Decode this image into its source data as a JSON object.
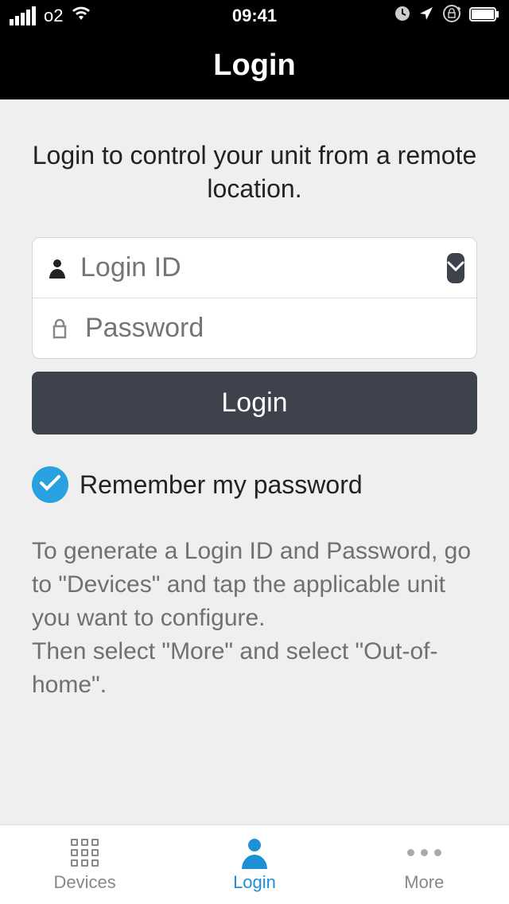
{
  "status": {
    "carrier": "o2",
    "time": "09:41"
  },
  "nav": {
    "title": "Login"
  },
  "subtitle": "Login to control your unit from a remote location.",
  "form": {
    "login_id_placeholder": "Login ID",
    "password_placeholder": "Password",
    "login_button": "Login"
  },
  "remember": {
    "label": "Remember my password",
    "checked": true
  },
  "help": {
    "text1": "To generate a Login ID and Password, go to \"Devices\" and tap the applicable unit you want to configure.",
    "text2": "Then select \"More\" and select \"Out-of-home\"."
  },
  "tabs": {
    "devices": "Devices",
    "login": "Login",
    "more": "More"
  }
}
